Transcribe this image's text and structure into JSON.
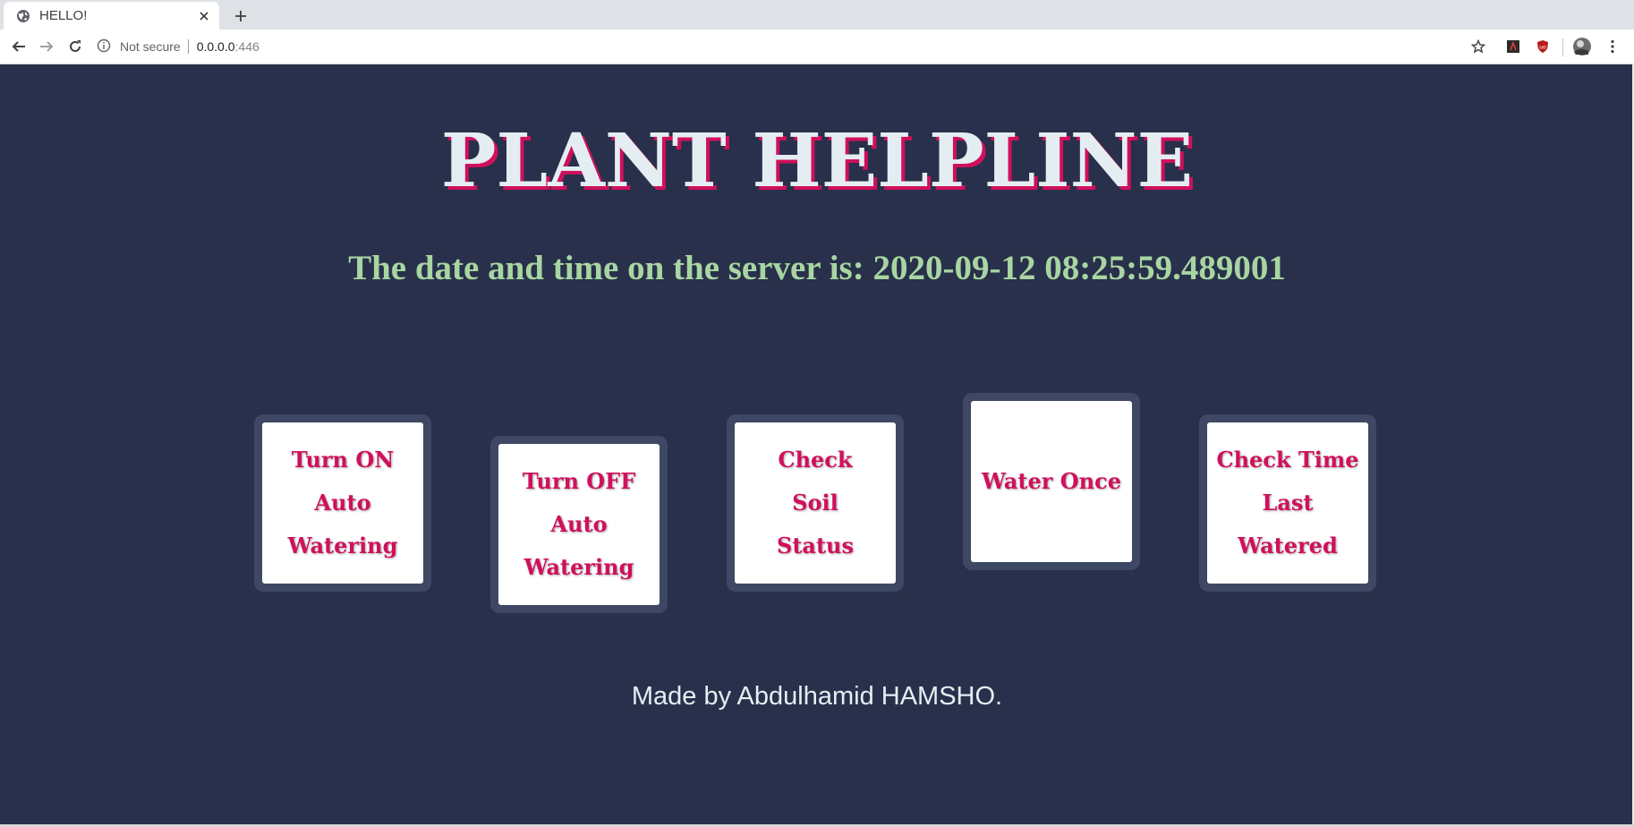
{
  "browser": {
    "tab_title": "HELLO!",
    "security_label": "Not secure",
    "url_host": "0.0.0.0",
    "url_port": ":446"
  },
  "page": {
    "heading": "PLANT HELPLINE",
    "datetime_prefix": "The date and time on the server is: ",
    "datetime_value": "2020-09-12 08:25:59.489001",
    "buttons": [
      {
        "label": "Turn ON Auto Watering"
      },
      {
        "label": "Turn OFF Auto Watering"
      },
      {
        "label": "Check Soil Status"
      },
      {
        "label": "Water Once"
      },
      {
        "label": "Check Time Last Watered"
      }
    ],
    "footer": "Made by Abdulhamid HAMSHO."
  },
  "colors": {
    "page_background": "#28304b",
    "heading_text": "#e4eef2",
    "heading_shadow": "#d0105c",
    "datetime_text": "#a8d5a1",
    "button_text": "#d0105c",
    "card_frame": "#3e4864"
  },
  "icons": {
    "tab_favicon": "globe-icon",
    "tab_close": "close-icon",
    "new_tab": "plus-icon",
    "back": "arrow-left-icon",
    "forward": "arrow-right-icon",
    "reload": "reload-icon",
    "site_info": "info-icon",
    "bookmark": "star-icon",
    "extension_1": "extension-icon",
    "extension_2": "shield-icon",
    "profile": "avatar",
    "menu": "kebab-menu-icon"
  }
}
